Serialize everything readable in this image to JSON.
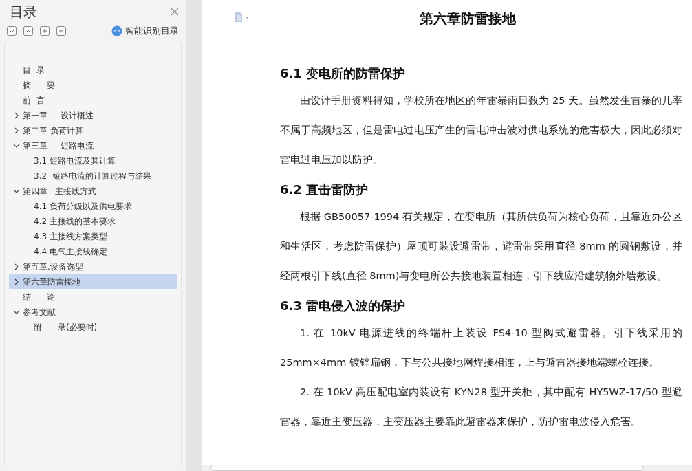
{
  "sidebar": {
    "title": "目录",
    "tools": [
      {
        "kind": "expand-down"
      },
      {
        "kind": "collapse-up"
      },
      {
        "kind": "plus"
      },
      {
        "kind": "minus"
      }
    ],
    "smart_button": "智能识别目录",
    "tree": [
      {
        "label": "目  录",
        "selected": false
      },
      {
        "label": "摘      要",
        "selected": false
      },
      {
        "label": "前  言",
        "selected": false
      },
      {
        "label": "第一章     设计概述",
        "expanded": false,
        "selected": false
      },
      {
        "label": "第二章 负荷计算",
        "expanded": false,
        "selected": false
      },
      {
        "label": "第三章     短路电流",
        "expanded": true,
        "selected": false,
        "children": [
          {
            "label": "3.1 短路电流及其计算",
            "selected": false
          },
          {
            "label": "3.2  短路电流的计算过程与结果",
            "selected": false
          }
        ]
      },
      {
        "label": "第四章   主接线方式",
        "expanded": true,
        "selected": false,
        "children": [
          {
            "label": "4.1 负荷分级以及供电要求",
            "selected": false
          },
          {
            "label": "4.2 主接线的基本要求",
            "selected": false
          },
          {
            "label": "4.3 主接线方案类型",
            "selected": false
          },
          {
            "label": "4.4 电气主接线确定",
            "selected": false
          }
        ]
      },
      {
        "label": "第五章.设备选型",
        "expanded": false,
        "selected": false
      },
      {
        "label": "第六章防雷接地",
        "expanded": false,
        "selected": true
      },
      {
        "label": "结      论",
        "selected": false
      },
      {
        "label": "参考文献",
        "expanded": true,
        "selected": false,
        "children": [
          {
            "label": "附      录(必要时)",
            "selected": false
          }
        ]
      }
    ]
  },
  "document": {
    "title": "第六章防雷接地",
    "blocks": [
      {
        "kind": "heading",
        "text": "6.1  变电所的防雷保护"
      },
      {
        "kind": "paragraph",
        "text": "由设计手册资料得知，学校所在地区的年雷暴雨日数为 25 天。虽然发生雷暴的几率不属于高频地区，但是雷电过电压产生的雷电冲击波对供电系统的危害极大，因此必须对雷电过电压加以防护。"
      },
      {
        "kind": "heading",
        "text": "6.2  直击雷防护"
      },
      {
        "kind": "paragraph",
        "text": "根据 GB50057-1994 有关规定，在变电所（其所供负荷为核心负荷，且靠近办公区和生活区，考虑防雷保护）屋顶可装设避雷带，避雷带采用直径 8mm 的圆钢敷设，并经两根引下线(直径 8mm)与变电所公共接地装置相连，引下线应沿建筑物外墙敷设。"
      },
      {
        "kind": "heading",
        "text": "6.3  雷电侵入波的保护"
      },
      {
        "kind": "paragraph",
        "text": "1. 在 10kV 电源进线的终端杆上装设 FS4-10 型阀式避雷器。引下线采用的 25mm×4mm 镀锌扁钢，下与公共接地网焊接相连，上与避雷器接地端螺栓连接。"
      },
      {
        "kind": "paragraph",
        "text": "2. 在 10kV 高压配电室内装设有 KYN28 型开关柜，其中配有 HY5WZ-17/50 型避雷器，靠近主变压器，主变压器主要靠此避雷器来保护，防护雷电波侵入危害。"
      }
    ]
  }
}
